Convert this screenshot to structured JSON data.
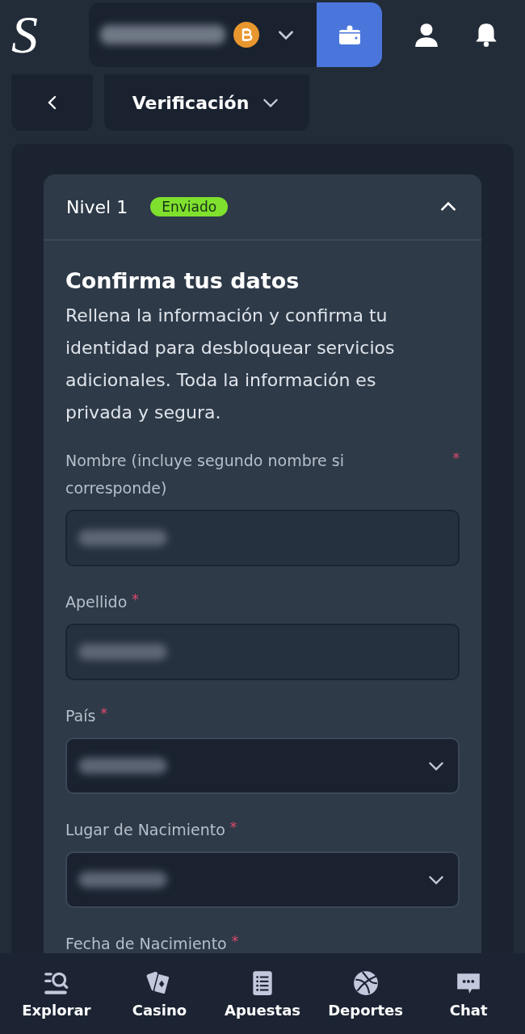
{
  "header": {
    "logo": "S"
  },
  "subnav": {
    "title": "Verificación"
  },
  "level_card": {
    "title": "Nivel 1",
    "badge": "Enviado",
    "expanded": true,
    "heading": "Confirma tus datos",
    "description": "Rellena la información y confirma tu identidad para desbloquear servicios adicionales. Toda la información es privada y segura.",
    "fields": [
      {
        "label": "Nombre (incluye segundo nombre si corresponde)",
        "required_mark": "*",
        "kind": "text"
      },
      {
        "label": "Apellido",
        "required_mark": "*",
        "kind": "text"
      },
      {
        "label": "País",
        "required_mark": "*",
        "kind": "select"
      },
      {
        "label": "Lugar de Nacimiento",
        "required_mark": "*",
        "kind": "select"
      },
      {
        "label": "Fecha de Nacimiento",
        "required_mark": "*",
        "kind": "partial"
      }
    ]
  },
  "bottom_nav": [
    {
      "label": "Explorar"
    },
    {
      "label": "Casino"
    },
    {
      "label": "Apuestas"
    },
    {
      "label": "Deportes"
    },
    {
      "label": "Chat"
    }
  ]
}
